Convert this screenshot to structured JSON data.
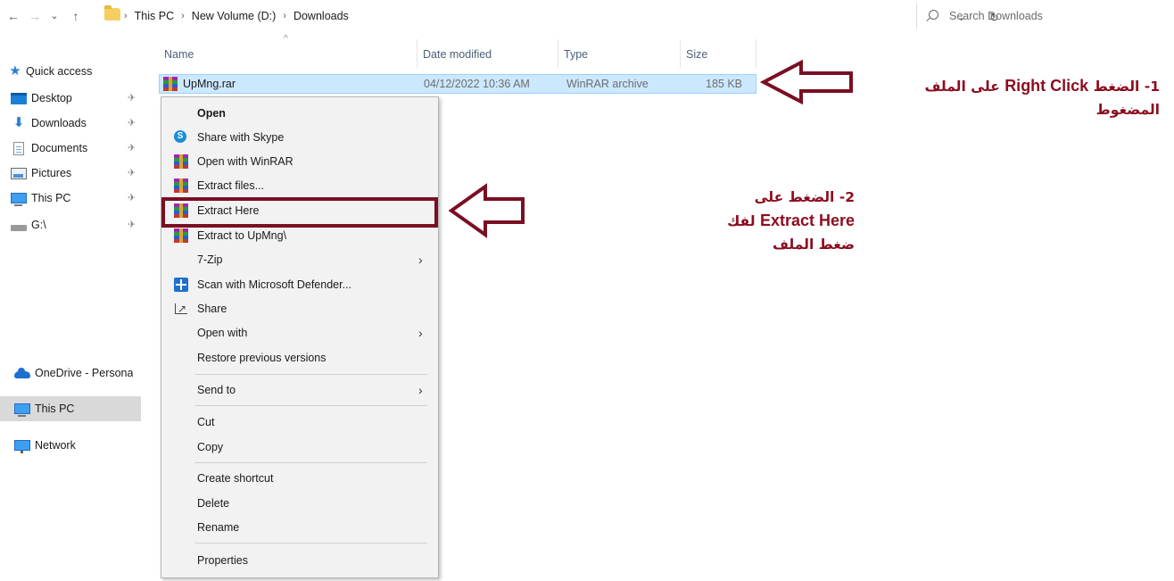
{
  "addressbar": {
    "back": "←",
    "forward": "→",
    "recent": "⌄",
    "up": "↑",
    "crumbs": [
      "This PC",
      "New Volume (D:)",
      "Downloads"
    ],
    "crumb_sep": "›",
    "dropdown": "⌄",
    "refresh": "↻",
    "search_placeholder": "Search Downloads"
  },
  "navpane": {
    "quick_access": "Quick access",
    "pinned": [
      {
        "label": "Desktop",
        "icon": "desktop-icon"
      },
      {
        "label": "Downloads",
        "icon": "download-icon"
      },
      {
        "label": "Documents",
        "icon": "documents-icon"
      },
      {
        "label": "Pictures",
        "icon": "pictures-icon"
      },
      {
        "label": "This PC",
        "icon": "this-pc-icon"
      },
      {
        "label": "G:\\",
        "icon": "drive-icon"
      }
    ],
    "pin_glyph": "✈",
    "onedrive": "OneDrive - Persona",
    "this_pc": "This PC",
    "network": "Network"
  },
  "filelist": {
    "columns": [
      "Name",
      "Date modified",
      "Type",
      "Size"
    ],
    "sort_glyph": "^",
    "rows": [
      {
        "name": "UpMng.rar",
        "date": "04/12/2022 10:36 AM",
        "type": "WinRAR archive",
        "size": "185 KB"
      }
    ]
  },
  "context_menu": {
    "open": "Open",
    "share_skype": "Share with Skype",
    "skype_letter": "S",
    "open_winrar": "Open with WinRAR",
    "extract_files": "Extract files...",
    "extract_here": "Extract Here",
    "extract_to": "Extract to UpMng\\",
    "seven_zip": "7-Zip",
    "defender": "Scan with Microsoft Defender...",
    "share": "Share",
    "open_with": "Open with",
    "restore": "Restore previous versions",
    "send_to": "Send to",
    "cut": "Cut",
    "copy": "Copy",
    "create_shortcut": "Create shortcut",
    "delete": "Delete",
    "rename": "Rename",
    "properties": "Properties",
    "submenu_arrow": "›"
  },
  "annotations": {
    "note1_prefix": "1- الضغط",
    "note1_en": "Right Click",
    "note1_suffix": "على الملف المضغوط",
    "note2_prefix": "2- الضغط على",
    "note2_en": "Extract Here",
    "note2_suffix": "لفك ضغط الملف",
    "color": "#8b0d1f"
  }
}
